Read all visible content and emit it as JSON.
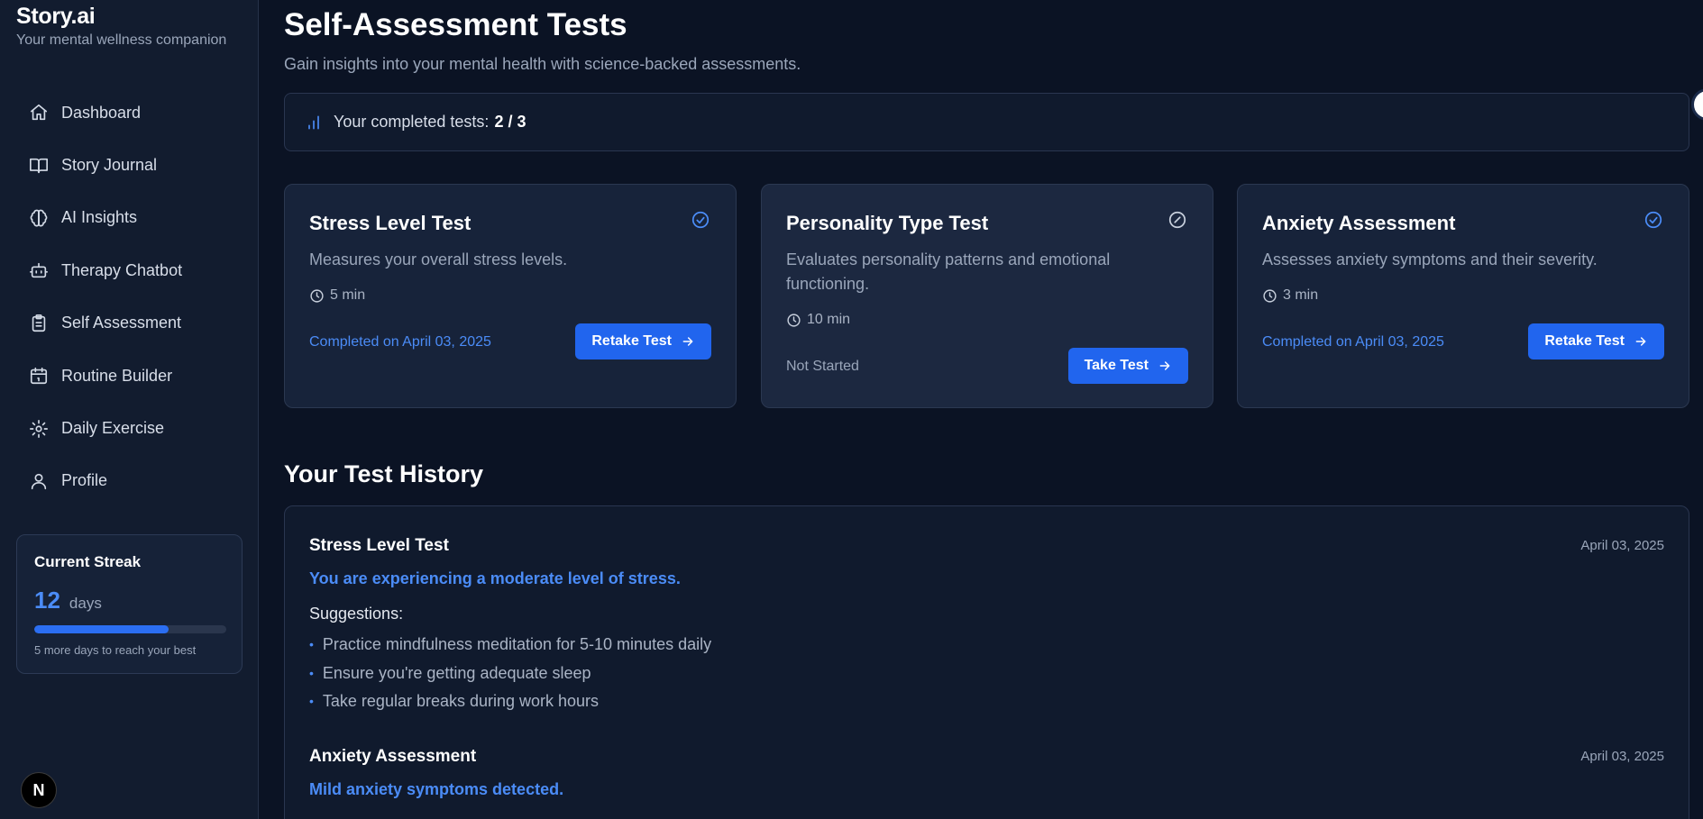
{
  "brand": {
    "title": "Story.ai",
    "subtitle": "Your mental wellness companion"
  },
  "sidebar": {
    "items": [
      {
        "label": "Dashboard",
        "icon": "home-icon"
      },
      {
        "label": "Story Journal",
        "icon": "book-open-icon"
      },
      {
        "label": "AI Insights",
        "icon": "brain-icon"
      },
      {
        "label": "Therapy Chatbot",
        "icon": "bot-icon"
      },
      {
        "label": "Self Assessment",
        "icon": "clipboard-list-icon"
      },
      {
        "label": "Routine Builder",
        "icon": "calendar-icon"
      },
      {
        "label": "Daily Exercise",
        "icon": "gear-icon"
      },
      {
        "label": "Profile",
        "icon": "user-icon"
      }
    ],
    "streak": {
      "title": "Current Streak",
      "count": "12",
      "unit": "days",
      "progress_fraction": 0.7,
      "note": "5 more days to reach your best"
    },
    "fab_label": "N"
  },
  "header": {
    "title": "Self-Assessment Tests",
    "subtitle": "Gain insights into your mental health with science-backed assessments."
  },
  "progress": {
    "label": "Your completed tests:",
    "value": "2 / 3"
  },
  "tests": [
    {
      "title": "Stress Level Test",
      "description": "Measures your overall stress levels.",
      "duration": "5 min",
      "status": "Completed on April 03, 2025",
      "completed": true,
      "button": "Retake Test"
    },
    {
      "title": "Personality Type Test",
      "description": "Evaluates personality patterns and emotional functioning.",
      "duration": "10 min",
      "status": "Not Started",
      "completed": false,
      "button": "Take Test"
    },
    {
      "title": "Anxiety Assessment",
      "description": "Assesses anxiety symptoms and their severity.",
      "duration": "3 min",
      "status": "Completed on April 03, 2025",
      "completed": true,
      "button": "Retake Test"
    }
  ],
  "history": {
    "title": "Your Test History",
    "entries": [
      {
        "name": "Stress Level Test",
        "date": "April 03, 2025",
        "result": "You are experiencing a moderate level of stress.",
        "suggestions_label": "Suggestions:",
        "suggestions": [
          "Practice mindfulness meditation for 5-10 minutes daily",
          "Ensure you're getting adequate sleep",
          "Take regular breaks during work hours"
        ]
      },
      {
        "name": "Anxiety Assessment",
        "date": "April 03, 2025",
        "result": "Mild anxiety symptoms detected."
      }
    ]
  },
  "colors": {
    "accent": "#2165ee",
    "accent_text": "#4b8cf7",
    "background": "#0b1324",
    "sidebar": "#121c2f"
  }
}
